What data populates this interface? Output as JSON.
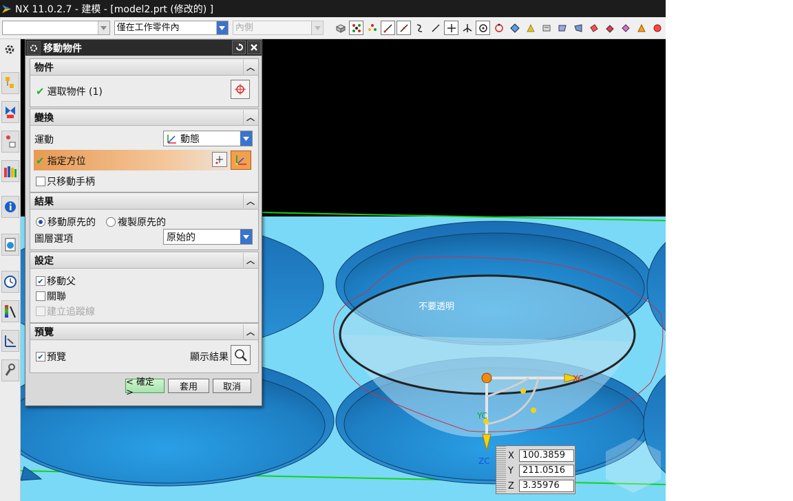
{
  "window": {
    "title": "NX 11.0.2.7 - 建模 - [model2.prt  (修改的) ]"
  },
  "toolbar": {
    "filter_value": "",
    "scope_value": "僅在工作零件內",
    "assembly_value": "內側",
    "icons": [
      "cube-icon",
      "snap-grid-icon",
      "snap-points-icon",
      "line-icon",
      "diagonal-line-icon",
      "curve-icon",
      "slash-icon",
      "cross-icon",
      "perpendicular-icon",
      "circle-center-icon",
      "circle-icon",
      "diamond-icon",
      "triangle-icon",
      "panel-icon",
      "flag-icon",
      "fan-icon",
      "paint-icon",
      "fill-icon",
      "diamond2-icon",
      "cone-icon"
    ]
  },
  "dialog": {
    "title": "移動物件",
    "objects": {
      "header": "物件",
      "select_label": "選取物件 (1)"
    },
    "transform": {
      "header": "變換",
      "motion_label": "運動",
      "motion_value": "動態",
      "specify_orientation": "指定方位",
      "move_handle_only": "只移動手柄"
    },
    "result": {
      "header": "結果",
      "move_original": "移動原先的",
      "copy_original": "複製原先的",
      "layer_label": "圖層選項",
      "layer_value": "原始的"
    },
    "settings": {
      "header": "設定",
      "move_parent": "移動父",
      "associative": "關聯",
      "create_trace": "建立追蹤線"
    },
    "preview": {
      "header": "預覽",
      "preview_label": "預覽",
      "show_result": "顯示結果"
    },
    "buttons": {
      "ok": "< 確定 >",
      "apply": "套用",
      "cancel": "取消"
    }
  },
  "viewport": {
    "annotation": "不要透明",
    "axes": {
      "x": "XC",
      "y": "YC",
      "z": "ZC"
    }
  },
  "coordinates": {
    "x_label": "X",
    "x_value": "100.3859",
    "y_label": "Y",
    "y_value": "211.0516",
    "z_label": "Z",
    "z_value": "3.35976"
  },
  "colors": {
    "accent": "#2b2b2b",
    "viewport_bg": "#7ad9f6",
    "dish": "#2f8fd0",
    "green_edge": "#18d018"
  }
}
